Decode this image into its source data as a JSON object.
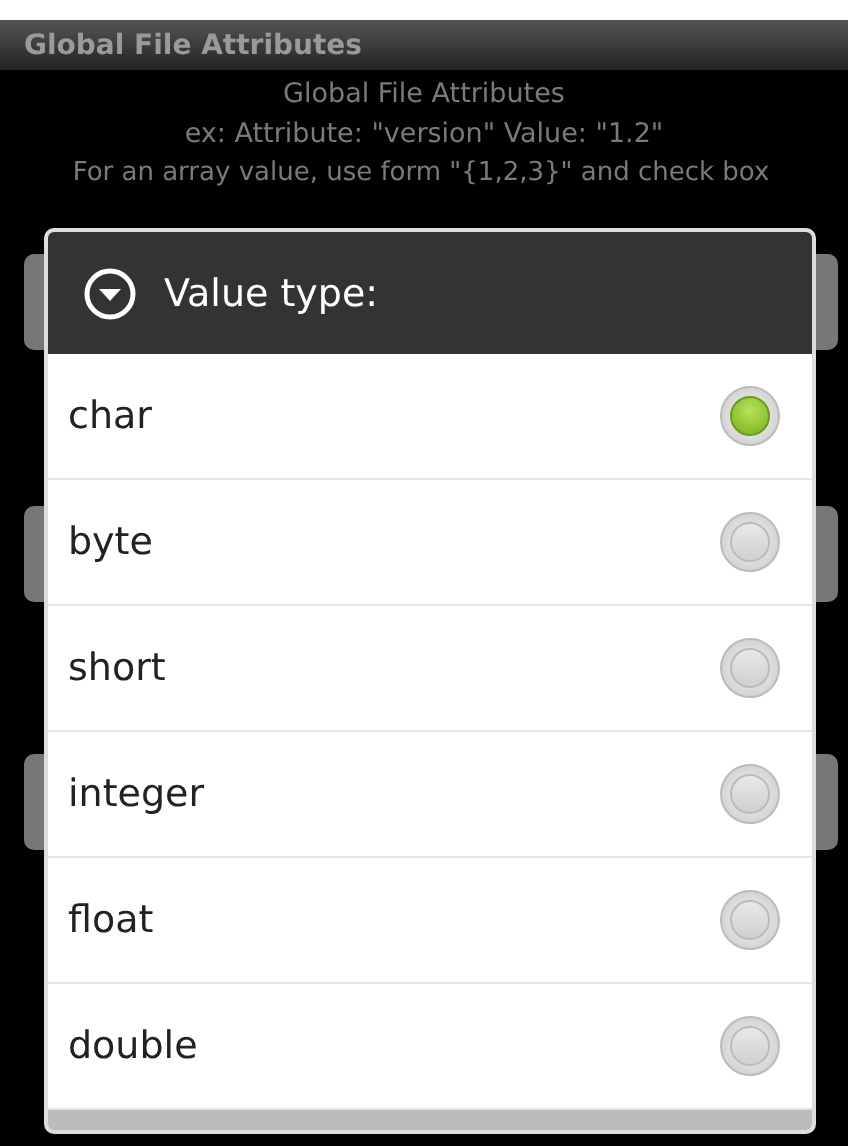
{
  "title_bar": {
    "title": "Global File Attributes"
  },
  "content": {
    "heading": "Global File Attributes",
    "example": "ex: Attribute: \"version\" Value: \"1.2\"",
    "hint": "For an array value, use form \"{1,2,3}\" and check box"
  },
  "dialog": {
    "title": "Value type:",
    "options": [
      {
        "label": "char",
        "selected": true
      },
      {
        "label": "byte",
        "selected": false
      },
      {
        "label": "short",
        "selected": false
      },
      {
        "label": "integer",
        "selected": false
      },
      {
        "label": "float",
        "selected": false
      },
      {
        "label": "double",
        "selected": false
      }
    ]
  }
}
